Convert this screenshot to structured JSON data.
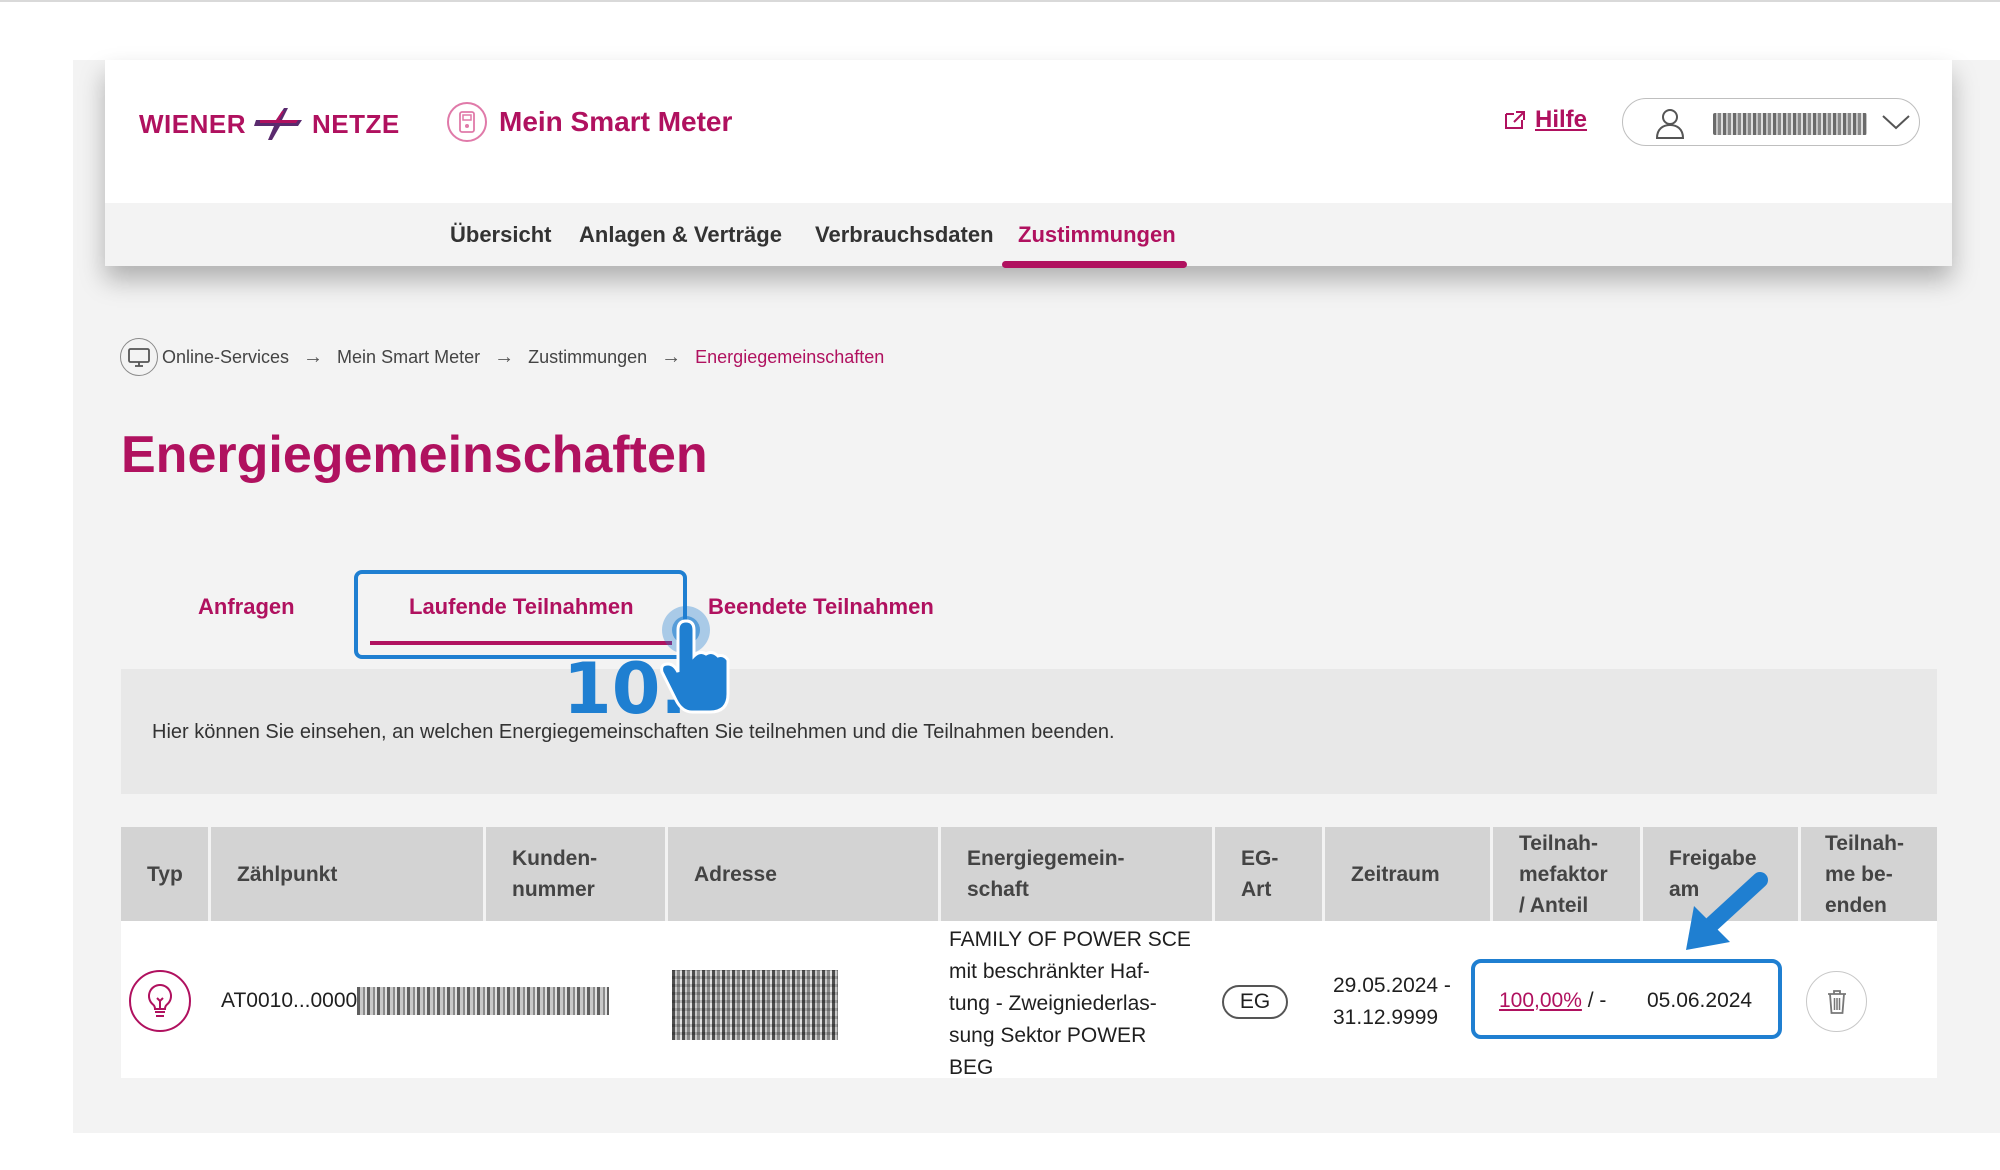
{
  "header": {
    "logo_left": "WIENER",
    "logo_right": "NETZE",
    "app_title": "Mein Smart Meter",
    "help_label": "Hilfe",
    "user_name": "",
    "nav": [
      "Übersicht",
      "Anlagen & Verträge",
      "Verbrauchsdaten",
      "Zustimmungen"
    ],
    "nav_active": "Zustimmungen"
  },
  "breadcrumb": [
    "Online-Services",
    "Mein Smart Meter",
    "Zustimmungen",
    "Energiegemeinschaften"
  ],
  "page_title": "Energiegemeinschaften",
  "tabs": [
    "Anfragen",
    "Laufende Teilnahmen",
    "Beendete Teilnahmen"
  ],
  "active_tab": "Laufende Teilnahmen",
  "step_annotation": "10.",
  "info_text": "Hier können Sie einsehen, an welchen Energiegemeinschaften Sie teilnehmen und die Teilnahmen beenden.",
  "table": {
    "headers": [
      [
        "Typ"
      ],
      [
        "Zählpunkt"
      ],
      [
        "Kunden-",
        "nummer"
      ],
      [
        "Adresse"
      ],
      [
        "Energiegemein-",
        "schaft"
      ],
      [
        "EG-",
        "Art"
      ],
      [
        "Zeitraum"
      ],
      [
        "Teilnah-",
        "mefaktor",
        "/ Anteil"
      ],
      [
        "Freigabe",
        "am"
      ],
      [
        "Teilnah-",
        "me be-",
        "enden"
      ]
    ],
    "row": {
      "type_icon": "lightbulb-icon",
      "zaehlpunkt": "AT0010...0000",
      "energy_community": [
        "FAMILY OF POWER SCE",
        "mit beschränkter Haf-",
        "tung - Zweigniederlas-",
        "sung Sektor POWER",
        "BEG"
      ],
      "eg_type": "EG",
      "period_start": "29.05.2024 -",
      "period_end": "31.12.9999",
      "share": "100,00%",
      "share_suffix": "/ -",
      "release_date": "05.06.2024",
      "delete_icon": "trash-icon"
    }
  },
  "colors": {
    "brand": "#b0115f",
    "annotation": "#1f7fd1"
  }
}
